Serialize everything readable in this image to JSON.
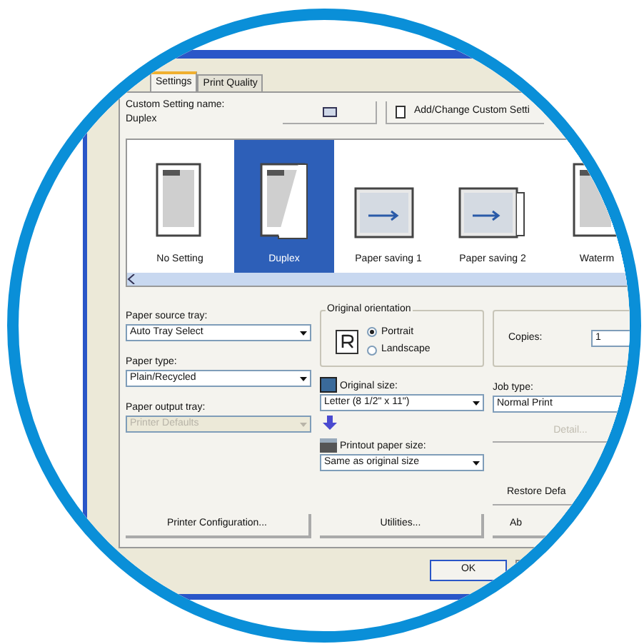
{
  "tabs": [
    {
      "label": "Settings",
      "selected": true
    },
    {
      "label": "Print Quality",
      "selected": false
    }
  ],
  "custom_setting": {
    "label": "Custom Setting name:",
    "value": "Duplex",
    "add_button": "Add/Change Custom Setti"
  },
  "presets": [
    {
      "label": "No Setting",
      "kind": "single",
      "selected": false
    },
    {
      "label": "Duplex",
      "kind": "duplex",
      "selected": true
    },
    {
      "label": "Paper saving 1",
      "kind": "saving1",
      "selected": false
    },
    {
      "label": "Paper saving 2",
      "kind": "saving2",
      "selected": false
    },
    {
      "label": "Waterm",
      "kind": "single",
      "selected": false
    }
  ],
  "paper_source_tray": {
    "label": "Paper source tray:",
    "value": "Auto Tray Select",
    "disabled": false
  },
  "paper_type": {
    "label": "Paper type:",
    "value": "Plain/Recycled",
    "disabled": false
  },
  "paper_output_tray": {
    "label": "Paper output tray:",
    "value": "Printer Defaults",
    "disabled": true
  },
  "original_orientation": {
    "label": "Original orientation",
    "options": [
      {
        "label": "Portrait",
        "selected": true
      },
      {
        "label": "Landscape",
        "selected": false
      }
    ]
  },
  "copies": {
    "label": "Copies:",
    "value": "1"
  },
  "original_size": {
    "label": "Original size:",
    "value": "Letter (8 1/2\" x 11\")",
    "disabled": false
  },
  "job_type": {
    "label": "Job type:",
    "value": "Normal Print",
    "disabled": false
  },
  "detail_button": {
    "label": "Detail...",
    "disabled": true
  },
  "printout_paper_size": {
    "label": "Printout paper size:",
    "value": "Same as original size",
    "disabled": false
  },
  "restore_button": "Restore Defa",
  "bottom_buttons": [
    "Printer Configuration...",
    "Utilities...",
    "Ab"
  ],
  "ok_button": "OK"
}
